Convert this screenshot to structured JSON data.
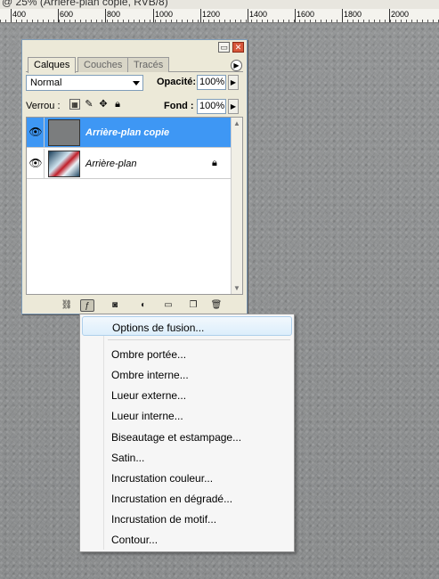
{
  "window": {
    "title_fragment": "@ 25% (Arrière-plan copie, RVB/8)"
  },
  "ruler": {
    "labels": [
      "400",
      "600",
      "800",
      "1000",
      "1200",
      "1400",
      "1600",
      "1800",
      "2000"
    ]
  },
  "panel": {
    "tabs": [
      {
        "label": "Calques",
        "active": true
      },
      {
        "label": "Couches",
        "active": false
      },
      {
        "label": "Tracés",
        "active": false
      }
    ],
    "blend_mode": "Normal",
    "opacity_label": "Opacité:",
    "opacity_value": "100%",
    "lock_label": "Verrou :",
    "fill_label": "Fond :",
    "fill_value": "100%",
    "layers": [
      {
        "name": "Arrière-plan copie",
        "selected": true,
        "visible": true,
        "locked": false
      },
      {
        "name": "Arrière-plan",
        "selected": false,
        "visible": true,
        "locked": true
      }
    ],
    "footer_icons": [
      "link-icon",
      "fx-icon",
      "mask-icon",
      "adjustment-icon",
      "folder-icon",
      "new-layer-icon",
      "trash-icon"
    ]
  },
  "context_menu": {
    "items": [
      {
        "label": "Options de fusion...",
        "highlighted": true
      },
      {
        "label": "Ombre portée..."
      },
      {
        "label": "Ombre interne..."
      },
      {
        "label": "Lueur externe..."
      },
      {
        "label": "Lueur interne..."
      },
      {
        "label": "Biseautage et estampage..."
      },
      {
        "label": "Satin..."
      },
      {
        "label": "Incrustation couleur..."
      },
      {
        "label": "Incrustation en dégradé..."
      },
      {
        "label": "Incrustation de motif..."
      },
      {
        "label": "Contour..."
      }
    ]
  },
  "colors": {
    "selection": "#3e97f4",
    "panel_bg": "#ece9d8",
    "canvas": "#8f9192"
  }
}
